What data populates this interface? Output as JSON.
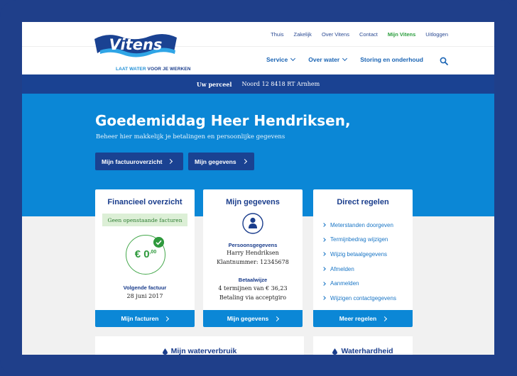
{
  "header": {
    "logo_text": "Vitens",
    "tagline_a": "LAAT WATER ",
    "tagline_b": "VOOR JE WERKEN",
    "utility_nav": [
      "Thuis",
      "Zakelijk",
      "Over Vitens",
      "Contact",
      "Mijn Vitens",
      "Uitloggen"
    ],
    "main_nav": {
      "service": "Service",
      "over_water": "Over water",
      "storing": "Storing en onderhoud"
    }
  },
  "parcel": {
    "label": "Uw perceel",
    "address": "Noord 12 8418 RT Arnhem"
  },
  "hero": {
    "greeting": "Goedemiddag Heer Hendriksen,",
    "subtitle": "Beheer hier makkelijk je betalingen en persoonlijke gegevens",
    "btn_invoices": "Mijn factuuroverzicht",
    "btn_details": "Mijn gegevens"
  },
  "financial": {
    "title": "Financieel overzicht",
    "badge": "Geen openstaande facturen",
    "amount_main": "€ 0",
    "amount_cents": ",00",
    "next_label": "Volgende factuur",
    "next_date": "28 juni 2017",
    "footer": "Mijn facturen"
  },
  "details": {
    "title": "Mijn gegevens",
    "personal_label": "Persoonsgegevens",
    "name": "Harry Hendriksen",
    "customer_number": "Klantnummer: 12345678",
    "payment_label": "Betaalwijze",
    "payment_terms": "4 termijnen van € 36,23",
    "payment_method": "Betaling via acceptgiro",
    "footer": "Mijn gegevens"
  },
  "direct": {
    "title": "Direct regelen",
    "links": [
      "Meterstanden doorgeven",
      "Termijnbedrag wijzigen",
      "Wijzig betaalgegevens",
      "Afmelden",
      "Aanmelden",
      "Wijzigen contactgegevens"
    ],
    "footer": "Meer regelen"
  },
  "lower": {
    "usage_title": "Mijn waterverbruik",
    "hardness_title": "Waterhardheid"
  },
  "colors": {
    "brand_blue": "#0b87d6",
    "navy": "#1a4292",
    "active_green": "#2a9d3c"
  }
}
